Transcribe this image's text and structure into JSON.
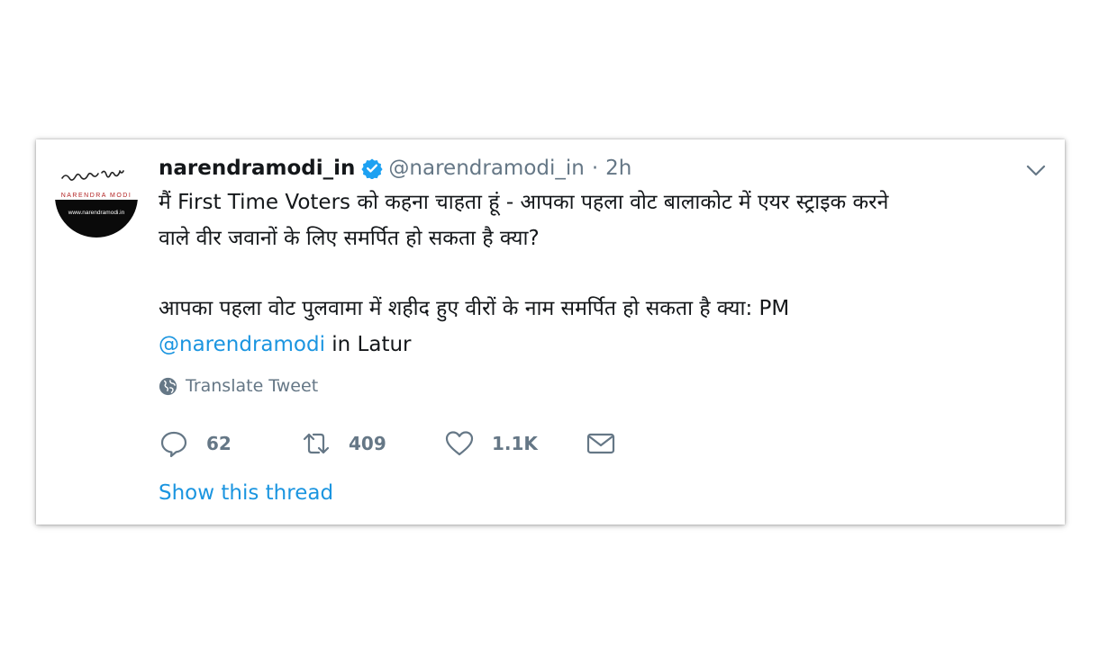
{
  "tweet": {
    "display_name": "narendramodi_in",
    "handle": "@narendramodi_in",
    "separator": "·",
    "time": "2h",
    "avatar": {
      "signature": "नरेन्द्र मोदी",
      "name_band": "NARENDRA MODI",
      "url": "www.narendramodi.in"
    },
    "text_line1": "मैं First Time Voters को कहना चाहता हूं - आपका पहला वोट बालाकोट में एयर स्ट्राइक करने",
    "text_line2": "वाले वीर जवानों के लिए समर्पित हो सकता है क्या?",
    "text_line3": "आपका पहला वोट पुलवामा में शहीद हुए वीरों के नाम समर्पित हो सकता है क्या: PM",
    "mention": "@narendramodi",
    "text_suffix": " in Latur",
    "translate_label": "Translate Tweet",
    "replies": "62",
    "retweets": "409",
    "likes": "1.1K",
    "show_thread": "Show this thread"
  },
  "colors": {
    "text": "#14171a",
    "muted": "#657786",
    "link": "#1b95e0",
    "verified": "#1da1f2"
  },
  "icons": [
    "verified-icon",
    "chevron-down-icon",
    "globe-icon",
    "reply-icon",
    "retweet-icon",
    "heart-icon",
    "mail-icon"
  ]
}
